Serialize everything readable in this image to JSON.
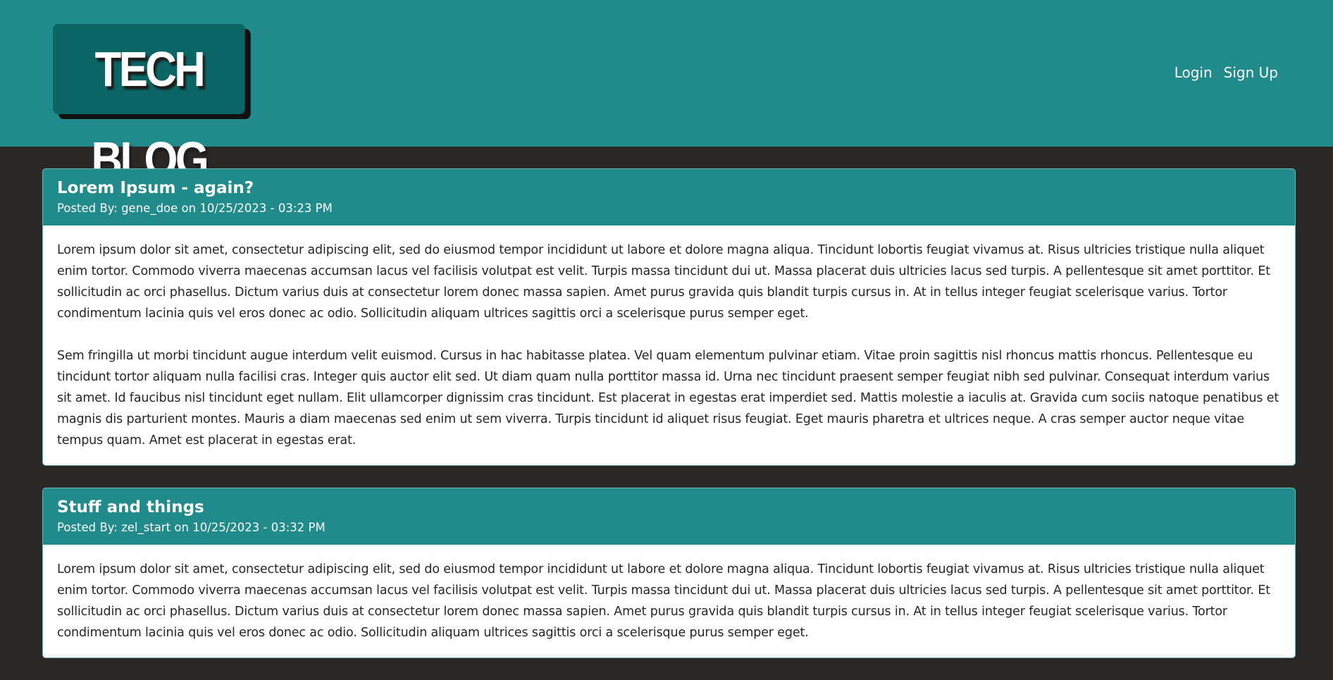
{
  "header": {
    "logo_text": "TECH BLOG",
    "nav": {
      "login": "Login",
      "signup": "Sign Up"
    }
  },
  "posts": [
    {
      "title": "Lorem Ipsum - again?",
      "meta": "Posted By: gene_doe on 10/25/2023 - 03:23 PM",
      "paragraphs": [
        "Lorem ipsum dolor sit amet, consectetur adipiscing elit, sed do eiusmod tempor incididunt ut labore et dolore magna aliqua. Tincidunt lobortis feugiat vivamus at. Risus ultricies tristique nulla aliquet enim tortor. Commodo viverra maecenas accumsan lacus vel facilisis volutpat est velit. Turpis massa tincidunt dui ut. Massa placerat duis ultricies lacus sed turpis. A pellentesque sit amet porttitor. Et sollicitudin ac orci phasellus. Dictum varius duis at consectetur lorem donec massa sapien. Amet purus gravida quis blandit turpis cursus in. At in tellus integer feugiat scelerisque varius. Tortor condimentum lacinia quis vel eros donec ac odio. Sollicitudin aliquam ultrices sagittis orci a scelerisque purus semper eget.",
        "Sem fringilla ut morbi tincidunt augue interdum velit euismod. Cursus in hac habitasse platea. Vel quam elementum pulvinar etiam. Vitae proin sagittis nisl rhoncus mattis rhoncus. Pellentesque eu tincidunt tortor aliquam nulla facilisi cras. Integer quis auctor elit sed. Ut diam quam nulla porttitor massa id. Urna nec tincidunt praesent semper feugiat nibh sed pulvinar. Consequat interdum varius sit amet. Id faucibus nisl tincidunt eget nullam. Elit ullamcorper dignissim cras tincidunt. Est placerat in egestas erat imperdiet sed. Mattis molestie a iaculis at. Gravida cum sociis natoque penatibus et magnis dis parturient montes. Mauris a diam maecenas sed enim ut sem viverra. Turpis tincidunt id aliquet risus feugiat. Eget mauris pharetra et ultrices neque. A cras semper auctor neque vitae tempus quam. Amet est placerat in egestas erat."
      ]
    },
    {
      "title": "Stuff and things",
      "meta": "Posted By: zel_start on 10/25/2023 - 03:32 PM",
      "paragraphs": [
        "Lorem ipsum dolor sit amet, consectetur adipiscing elit, sed do eiusmod tempor incididunt ut labore et dolore magna aliqua. Tincidunt lobortis feugiat vivamus at. Risus ultricies tristique nulla aliquet enim tortor. Commodo viverra maecenas accumsan lacus vel facilisis volutpat est velit. Turpis massa tincidunt dui ut. Massa placerat duis ultricies lacus sed turpis. A pellentesque sit amet porttitor. Et sollicitudin ac orci phasellus. Dictum varius duis at consectetur lorem donec massa sapien. Amet purus gravida quis blandit turpis cursus in. At in tellus integer feugiat scelerisque varius. Tortor condimentum lacinia quis vel eros donec ac odio. Sollicitudin aliquam ultrices sagittis orci a scelerisque purus semper eget."
      ]
    }
  ],
  "colors": {
    "header_bg": "#218a8a",
    "logo_bg": "#0b6565",
    "page_bg": "#292826",
    "card_bg": "#ffffff"
  }
}
